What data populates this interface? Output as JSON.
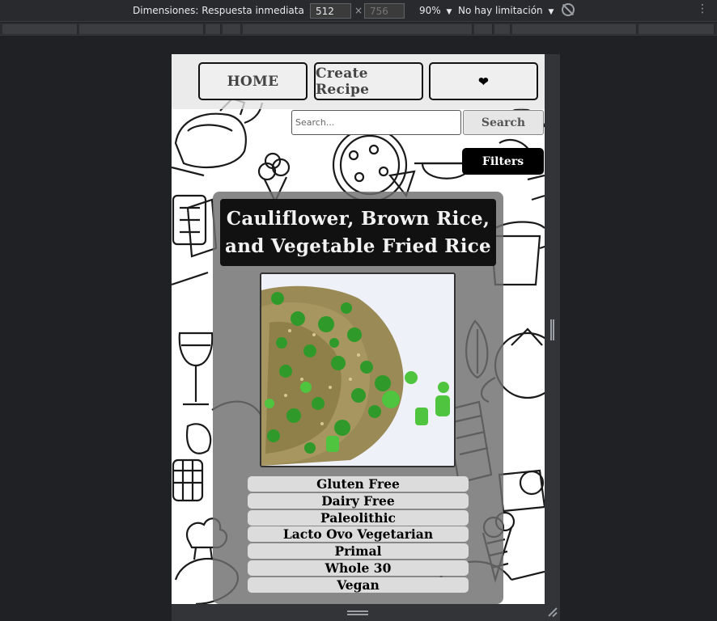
{
  "devtools": {
    "dimensions_label": "Dimensiones: Respuesta inmediata",
    "width_value": "512",
    "height_placeholder": "756",
    "times": "×",
    "zoom_label": "90%",
    "throttle_label": "No hay limitación",
    "dropdown_arrow": "▼",
    "more_icon": "⋮"
  },
  "nav": {
    "home_label": "HOME",
    "create_label": "Create Recipe",
    "favorites_label": "❤"
  },
  "search": {
    "placeholder": "Search...",
    "button_label": "Search"
  },
  "filters": {
    "button_label": "Filters"
  },
  "recipe": {
    "title": "Cauliflower, Brown Rice, and Vegetable Fried Rice",
    "diets": [
      "Gluten Free",
      "Dairy Free",
      "Paleolithic",
      "Lacto Ovo Vegetarian",
      "Primal",
      "Whole 30",
      "Vegan"
    ]
  },
  "colors": {
    "devtools_bg": "#292a2d",
    "page_bg": "#ffffff",
    "card_bg": "#6e6e6e",
    "title_bg": "#111111",
    "diet_bg": "#dcdcdc",
    "filters_bg": "#000000"
  }
}
